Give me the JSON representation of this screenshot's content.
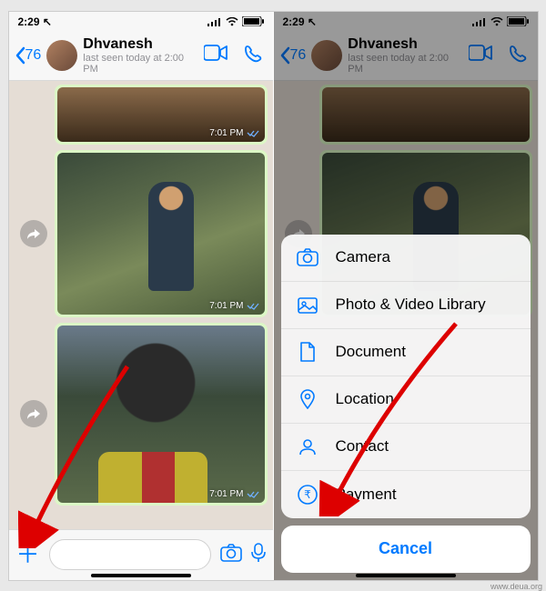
{
  "status": {
    "time": "2:29",
    "location_arrow": "↗"
  },
  "nav": {
    "back_count": "76",
    "contact_name": "Dhvanesh",
    "last_seen": "last seen today at 2:00 PM"
  },
  "messages": [
    {
      "timestamp": "7:01 PM"
    },
    {
      "timestamp": "7:01 PM"
    },
    {
      "timestamp": "7:01 PM"
    }
  ],
  "sheet": {
    "items": [
      {
        "icon": "camera-icon",
        "label": "Camera"
      },
      {
        "icon": "photo-library-icon",
        "label": "Photo & Video Library"
      },
      {
        "icon": "document-icon",
        "label": "Document"
      },
      {
        "icon": "location-icon",
        "label": "Location"
      },
      {
        "icon": "contact-icon",
        "label": "Contact"
      },
      {
        "icon": "payment-icon",
        "label": "Payment"
      }
    ],
    "cancel": "Cancel"
  },
  "watermark": "www.deua.org"
}
